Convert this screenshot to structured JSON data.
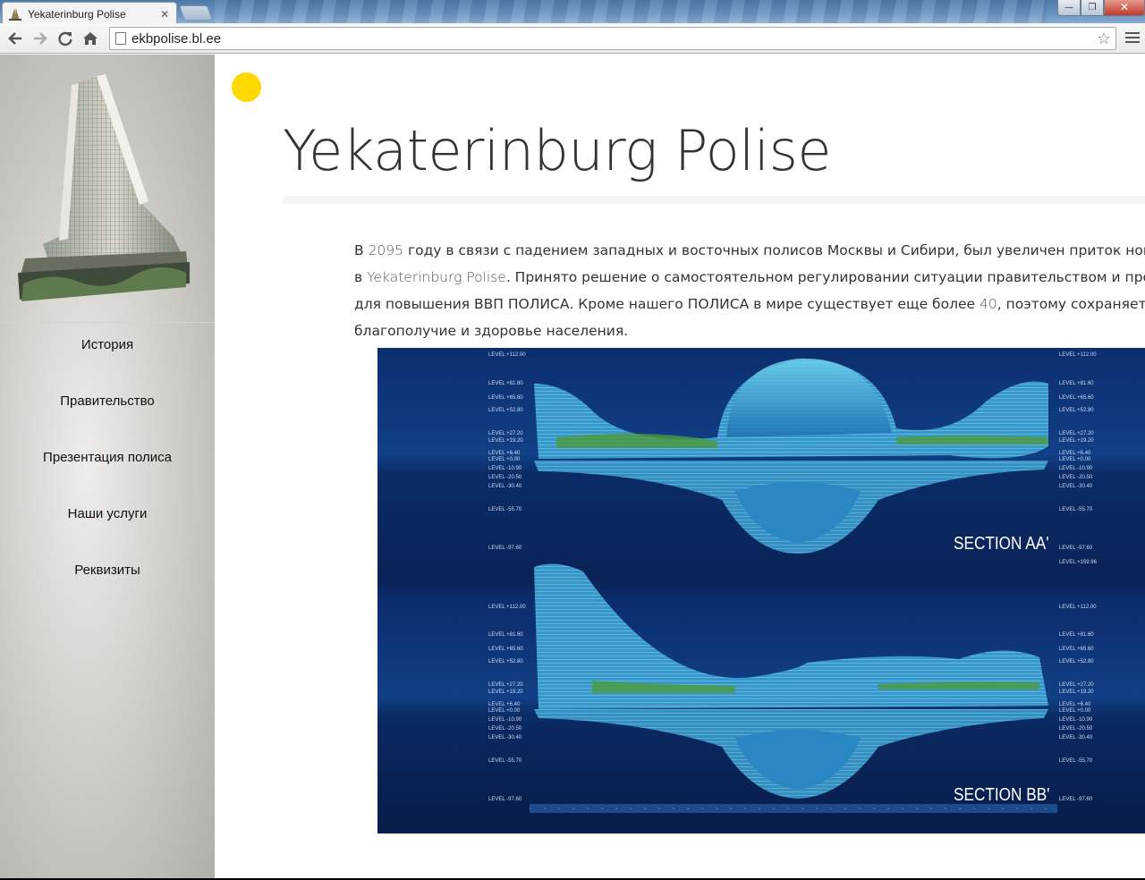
{
  "browser": {
    "tab_title": "Yekaterinburg Polise",
    "tab_close": "✕",
    "url": "ekbpolise.bl.ee",
    "star": "☆",
    "win_minimize": "—",
    "win_maximize": "❐",
    "win_close": "✕"
  },
  "sidebar": {
    "items": [
      {
        "label": "История"
      },
      {
        "label": "Правительство"
      },
      {
        "label": "Презентация полиса"
      },
      {
        "label": "Наши услуги"
      },
      {
        "label": "Реквизиты"
      }
    ]
  },
  "page": {
    "title": "Yekaterinburg Polise",
    "accent_color": "#ffd800",
    "intro": {
      "l1_a": "В ",
      "l1_year": "2095",
      "l1_b": " году в связи с падением западных и восточных полисов Москвы и Сибири, был увеличен приток новы",
      "l2_a": "в ",
      "l2_name": "Yekaterinburg Polise",
      "l2_b": ". Принято решение о самостоятельном регулировании ситуации правительством и про",
      "l3_a": "для повышения ВВП ПОЛИСА. Кроме нашего ПОЛИСА в мире существует еще более ",
      "l3_num": "40",
      "l3_b": ", поэтому сохраняется",
      "l4": "благополучие и здоровье населения."
    },
    "image": {
      "section_a": "SECTION AA'",
      "section_b": "SECTION BB'",
      "levels_top": [
        "LEVEL +112.00",
        "LEVEL +81.60",
        "LEVEL +65.60",
        "LEVEL +52.80",
        "LEVEL +27.20",
        "LEVEL +19.20",
        "LEVEL +6.40",
        "LEVEL +0.00",
        "LEVEL -10.90",
        "LEVEL -20.50",
        "LEVEL -30.40",
        "LEVEL -55.70",
        "LEVEL -97.60"
      ],
      "levels_bottom": [
        "LEVEL +159.96",
        "LEVEL +112.00",
        "LEVEL +81.60",
        "LEVEL +65.60",
        "LEVEL +52.80",
        "LEVEL +27.20",
        "LEVEL +19.20",
        "LEVEL +6.40",
        "LEVEL +0.00",
        "LEVEL -10.90",
        "LEVEL -20.50",
        "LEVEL -30.40",
        "LEVEL -55.70",
        "LEVEL -97.60"
      ]
    }
  }
}
